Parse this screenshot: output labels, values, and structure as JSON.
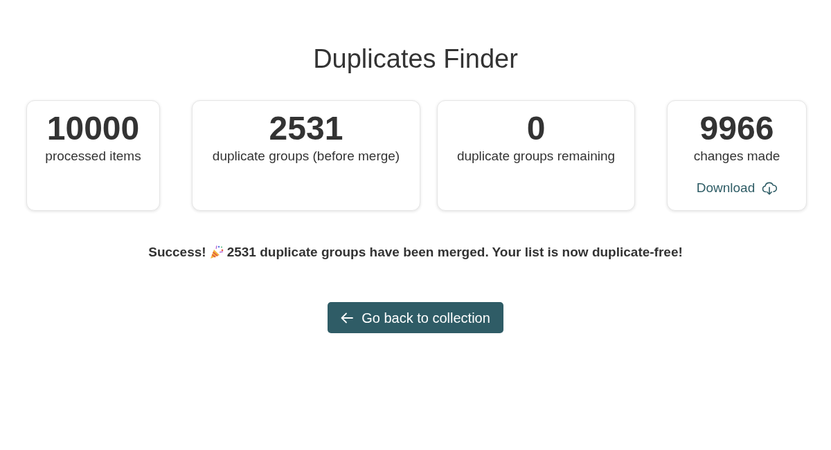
{
  "page": {
    "title": "Duplicates Finder"
  },
  "stats": [
    {
      "value": "10000",
      "label": "processed items"
    },
    {
      "value": "2531",
      "label": "duplicate groups (before merge)"
    },
    {
      "value": "0",
      "label": "duplicate groups remaining"
    },
    {
      "value": "9966",
      "label": "changes made",
      "link": {
        "label": "Download"
      }
    }
  ],
  "success": {
    "lead": "Success!",
    "message": "2531 duplicate groups have been merged. Your list is now duplicate-free!"
  },
  "back_button": {
    "label": "Go back to collection"
  }
}
